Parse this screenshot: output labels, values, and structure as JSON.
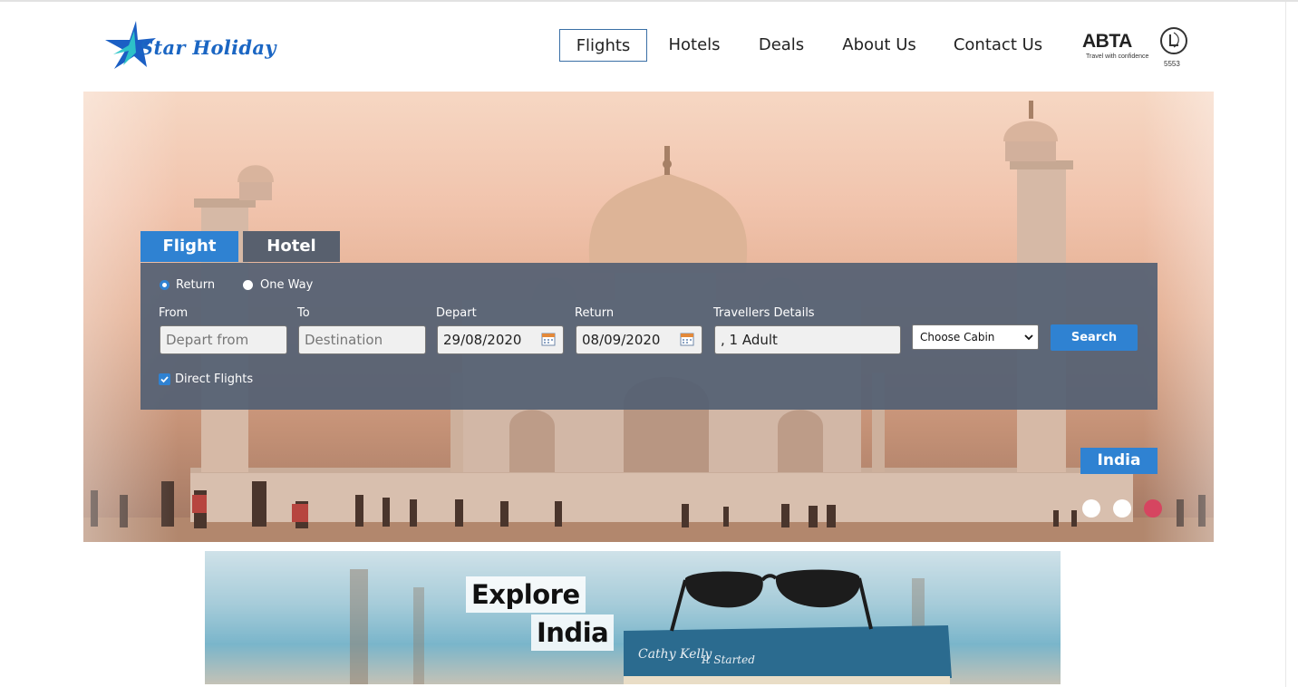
{
  "brand": {
    "name": "Star Holiday"
  },
  "nav": {
    "items": [
      {
        "label": "Flights",
        "active": true
      },
      {
        "label": "Hotels",
        "active": false
      },
      {
        "label": "Deals",
        "active": false
      },
      {
        "label": "About Us",
        "active": false
      },
      {
        "label": "Contact Us",
        "active": false
      }
    ]
  },
  "abta": {
    "name": "ABTA",
    "tagline": "Travel with confidence",
    "number": "5553"
  },
  "search": {
    "tabs": {
      "flight": "Flight",
      "hotel": "Hotel"
    },
    "active_tab": "Flight",
    "trip_type": {
      "return_label": "Return",
      "oneway_label": "One Way",
      "selected": "Return"
    },
    "labels": {
      "from": "From",
      "to": "To",
      "depart": "Depart",
      "return": "Return",
      "travellers": "Travellers Details"
    },
    "from_placeholder": "Depart from",
    "to_placeholder": "Destination",
    "depart_date": "29/08/2020",
    "return_date": "08/09/2020",
    "travellers_value": ", 1 Adult",
    "cabin_selected": "Choose Cabin",
    "search_button": "Search",
    "direct_flights_label": "Direct Flights",
    "direct_flights_checked": true
  },
  "hero": {
    "destination_label": "India",
    "slide_count": 3,
    "active_slide": 3
  },
  "colors": {
    "accent": "#2f82d2",
    "tab_inactive": "#58606e",
    "active_dot": "#d64560"
  },
  "banner": {
    "line1": "Explore",
    "line2": "India"
  }
}
